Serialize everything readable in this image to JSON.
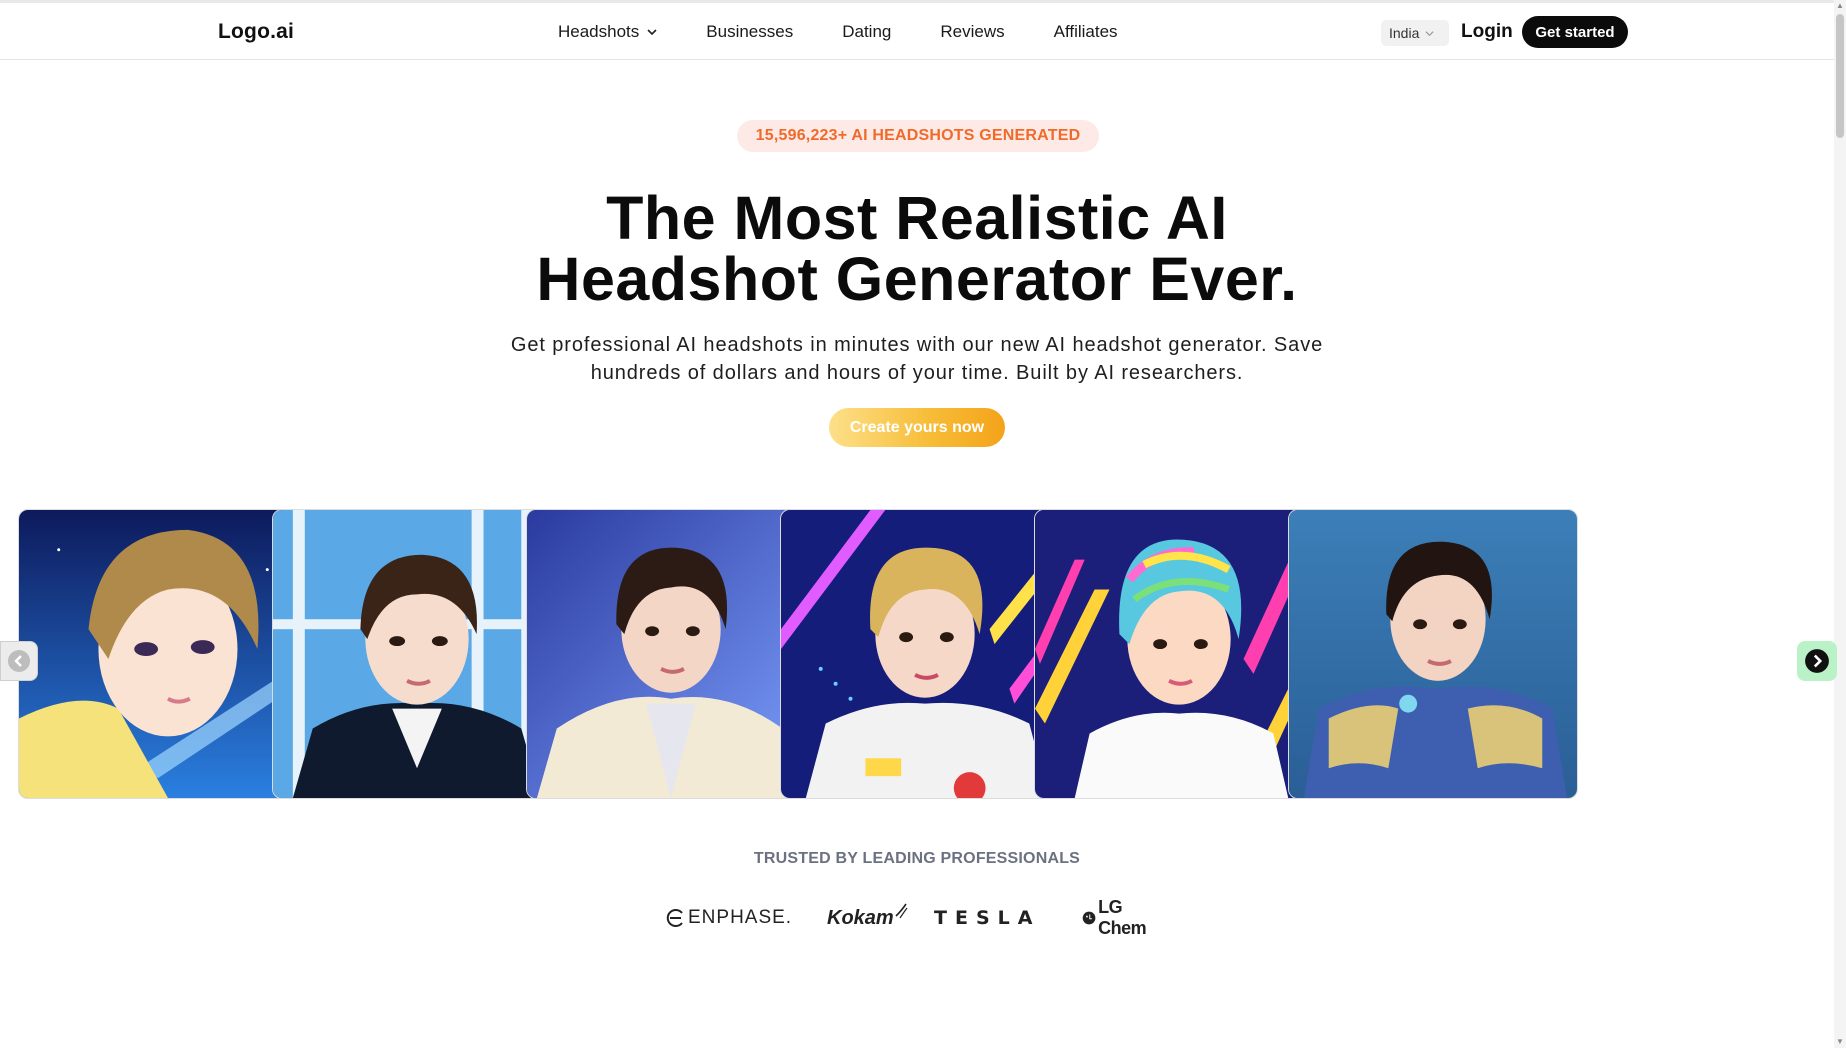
{
  "nav": {
    "logo": "Logo.ai",
    "items": [
      "Headshots",
      "Businesses",
      "Dating",
      "Reviews",
      "Affiliates"
    ],
    "country": "India",
    "login": "Login",
    "get_started": "Get started"
  },
  "hero": {
    "badge": "15,596,223+ AI HEADSHOTS GENERATED",
    "headline_line1": "The Most Realistic AI",
    "headline_line2": "Headshot Generator Ever.",
    "subtext_line1": "Get professional AI headshots in minutes with our new AI headshot generator. Save",
    "subtext_line2": "hundreds of dollars and hours of your time. Built by AI researchers.",
    "cta": "Create yours now"
  },
  "gallery": {
    "images": [
      {
        "name": "anime-style-portrait-starry-background"
      },
      {
        "name": "suit-portrait-blue-window-background"
      },
      {
        "name": "cream-jacket-portrait-blue-background"
      },
      {
        "name": "racing-jacket-portrait-neon-background"
      },
      {
        "name": "rainbow-hair-portrait-neon-stripes"
      },
      {
        "name": "armor-portrait-blue-background"
      }
    ]
  },
  "trusted": {
    "heading": "TRUSTED BY LEADING PROFESSIONALS",
    "brands": [
      "ENPHASE.",
      "Kokam",
      "TESLA",
      "LG Chem"
    ]
  },
  "colors": {
    "accent_orange": "#f06a2a",
    "badge_bg": "#fdeae6",
    "cta_start": "#fde08a",
    "cta_end": "#f4a31a",
    "dark": "#0b0b0b",
    "arrow_green": "#b9f2c7"
  }
}
